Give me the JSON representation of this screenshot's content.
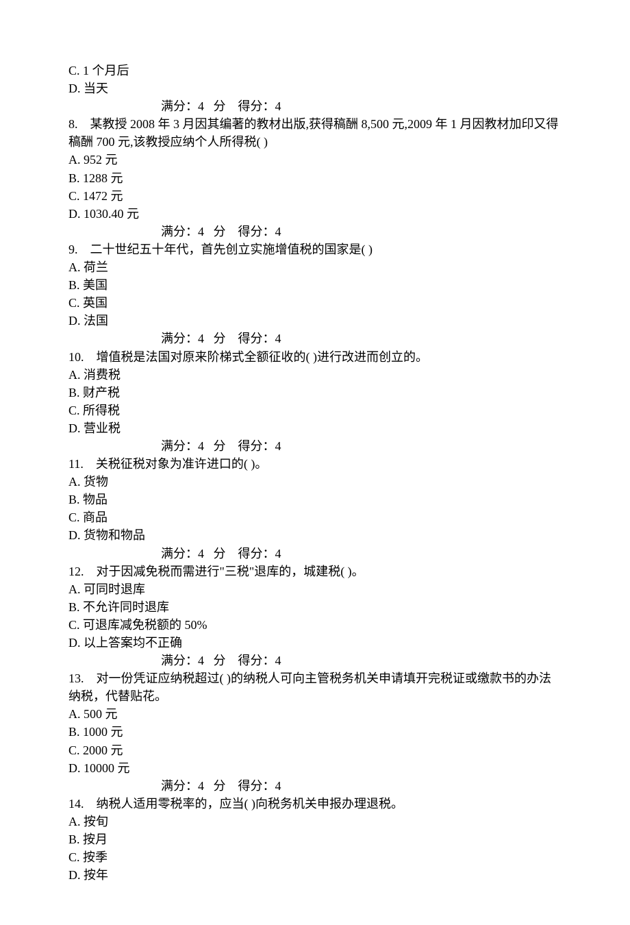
{
  "leading": [
    "C. 1 个月后",
    "D. 当天"
  ],
  "score_line": "满分：4   分    得分：4",
  "questions": [
    {
      "num": "8.",
      "stem": "某教授 2008 年 3 月因其编著的教材出版,获得稿酬 8,500 元,2009 年 1 月因教材加印又得稿酬 700 元,该教授应纳个人所得税( )",
      "opts": [
        "A. 952 元",
        "B. 1288 元",
        "C. 1472 元",
        "D. 1030.40 元"
      ]
    },
    {
      "num": "9.",
      "stem": "二十世纪五十年代，首先创立实施增值税的国家是( )",
      "opts": [
        "A. 荷兰",
        "B. 美国",
        "C. 英国",
        "D. 法国"
      ]
    },
    {
      "num": "10.",
      "stem": "增值税是法国对原来阶梯式全额征收的( )进行改进而创立的。",
      "opts": [
        "A. 消费税",
        "B. 财产税",
        "C. 所得税",
        "D. 营业税"
      ]
    },
    {
      "num": "11.",
      "stem": "关税征税对象为准许进口的( )。",
      "opts": [
        "A. 货物",
        "B. 物品",
        "C. 商品",
        "D. 货物和物品"
      ]
    },
    {
      "num": "12.",
      "stem": "对于因减免税而需进行\"三税\"退库的，城建税( )。",
      "opts": [
        "A. 可同时退库",
        "B. 不允许同时退库",
        "C. 可退库减免税额的 50%",
        "D. 以上答案均不正确"
      ]
    },
    {
      "num": "13.",
      "stem": "对一份凭证应纳税超过( )的纳税人可向主管税务机关申请填开完税证或缴款书的办法纳税，代替贴花。",
      "opts": [
        "A. 500 元",
        "B. 1000 元",
        "C. 2000 元",
        "D. 10000 元"
      ]
    },
    {
      "num": "14.",
      "stem": "纳税人适用零税率的，应当( )向税务机关申报办理退税。",
      "opts": [
        "A. 按旬",
        "B. 按月",
        "C. 按季",
        "D. 按年"
      ]
    }
  ]
}
